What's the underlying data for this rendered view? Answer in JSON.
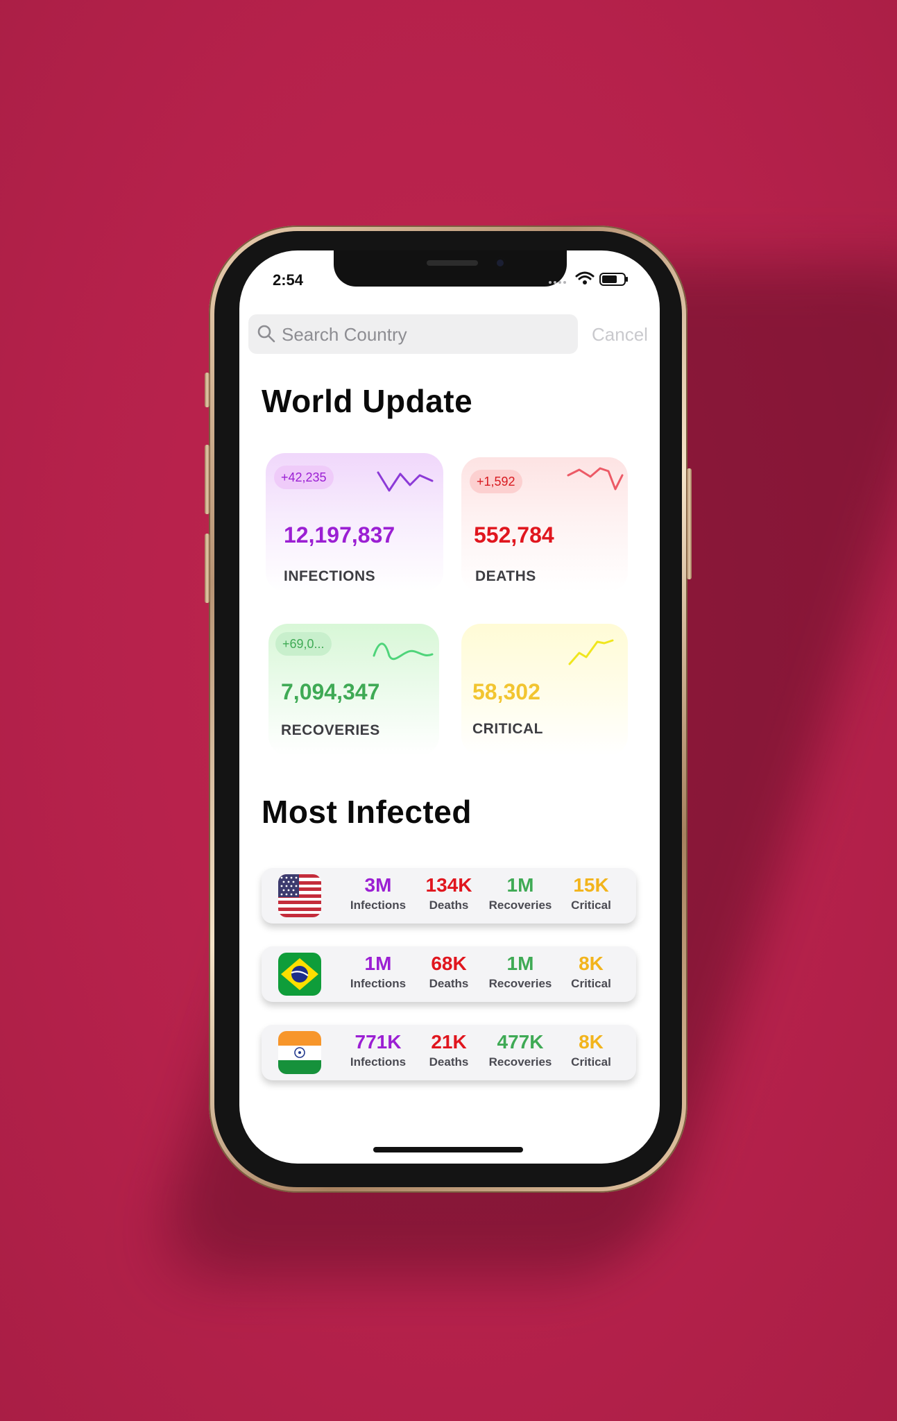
{
  "status_bar": {
    "time": "2:54"
  },
  "search": {
    "placeholder": "Search Country",
    "cancel_label": "Cancel"
  },
  "world_update": {
    "title": "World Update",
    "cards": [
      {
        "key": "infections",
        "delta": "+42,235",
        "value": "12,197,837",
        "label": "INFECTIONS",
        "color": "#9b1fd3"
      },
      {
        "key": "deaths",
        "delta": "+1,592",
        "value": "552,784",
        "label": "DEATHS",
        "color": "#e0161e"
      },
      {
        "key": "recoveries",
        "delta": "+69,0...",
        "value": "7,094,347",
        "label": "RECOVERIES",
        "color": "#3faa55"
      },
      {
        "key": "critical",
        "delta": "",
        "value": "58,302",
        "label": "CRITICAL",
        "color": "#f2c530"
      }
    ]
  },
  "most_infected": {
    "title": "Most Infected",
    "rows": [
      {
        "flag": "usa-flag",
        "infections": "3M",
        "deaths": "134K",
        "recoveries": "1M",
        "critical": "15K"
      },
      {
        "flag": "brazil-flag",
        "infections": "1M",
        "deaths": "68K",
        "recoveries": "1M",
        "critical": "8K"
      },
      {
        "flag": "india-flag",
        "infections": "771K",
        "deaths": "21K",
        "recoveries": "477K",
        "critical": "8K"
      }
    ],
    "labels": {
      "infections": "Infections",
      "deaths": "Deaths",
      "recoveries": "Recoveries",
      "critical": "Critical"
    }
  },
  "colors": {
    "background": "#b8224d",
    "infections": "#9b1fd3",
    "deaths": "#e0161e",
    "recoveries": "#3faa55",
    "critical": "#f2b41c"
  }
}
